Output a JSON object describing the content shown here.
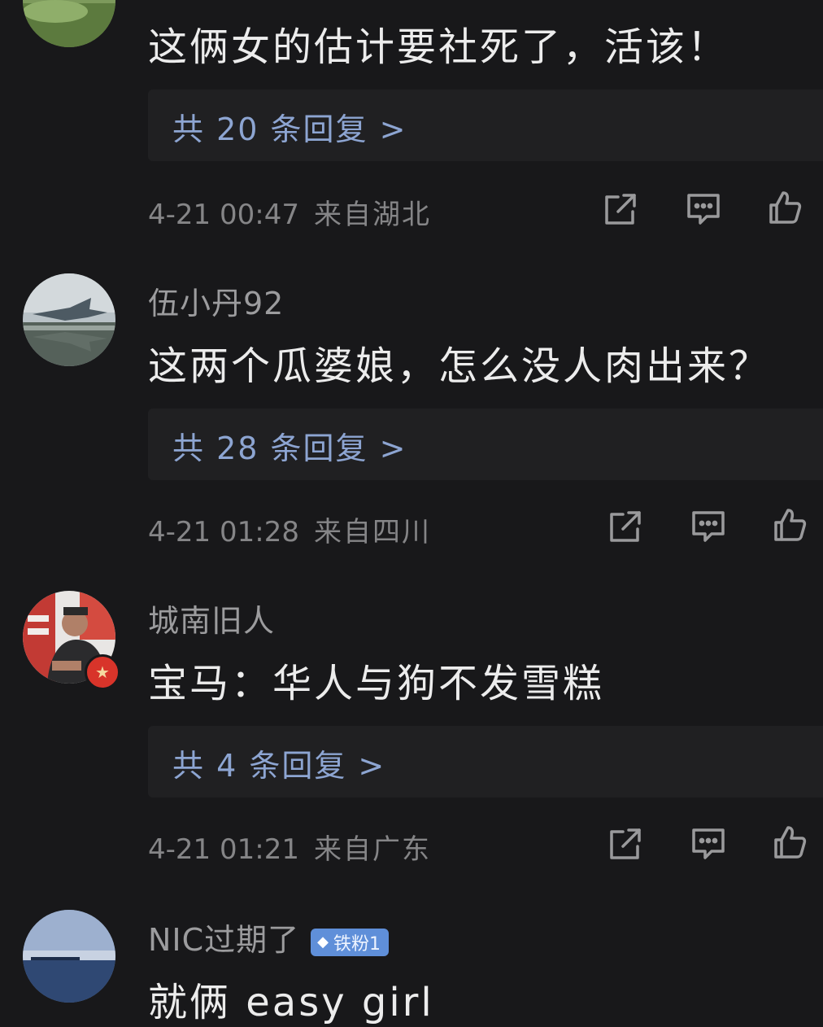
{
  "comments": [
    {
      "text": "这俩女的估计要社死了，活该！",
      "replies": "共 20 条回复 >",
      "time": "4-21 00:47",
      "location": "来自湖北"
    },
    {
      "username": "伍小丹92",
      "text": "这两个瓜婆娘，怎么没人肉出来？",
      "replies": "共 28 条回复 >",
      "time": "4-21 01:28",
      "location": "来自四川"
    },
    {
      "username": "城南旧人",
      "text": "宝马：华人与狗不发雪糕",
      "replies": "共 4 条回复 >",
      "time": "4-21 01:21",
      "location": "来自广东"
    },
    {
      "username": "NIC过期了",
      "badge": "铁粉1",
      "text": "就俩 easy girl"
    }
  ],
  "icons": {
    "share": "share-icon",
    "comment": "comment-icon",
    "like": "thumbs-up-icon"
  },
  "colors": {
    "background": "#18181a",
    "reply_link": "#8da5d2",
    "badge": "#5f8fd9"
  }
}
